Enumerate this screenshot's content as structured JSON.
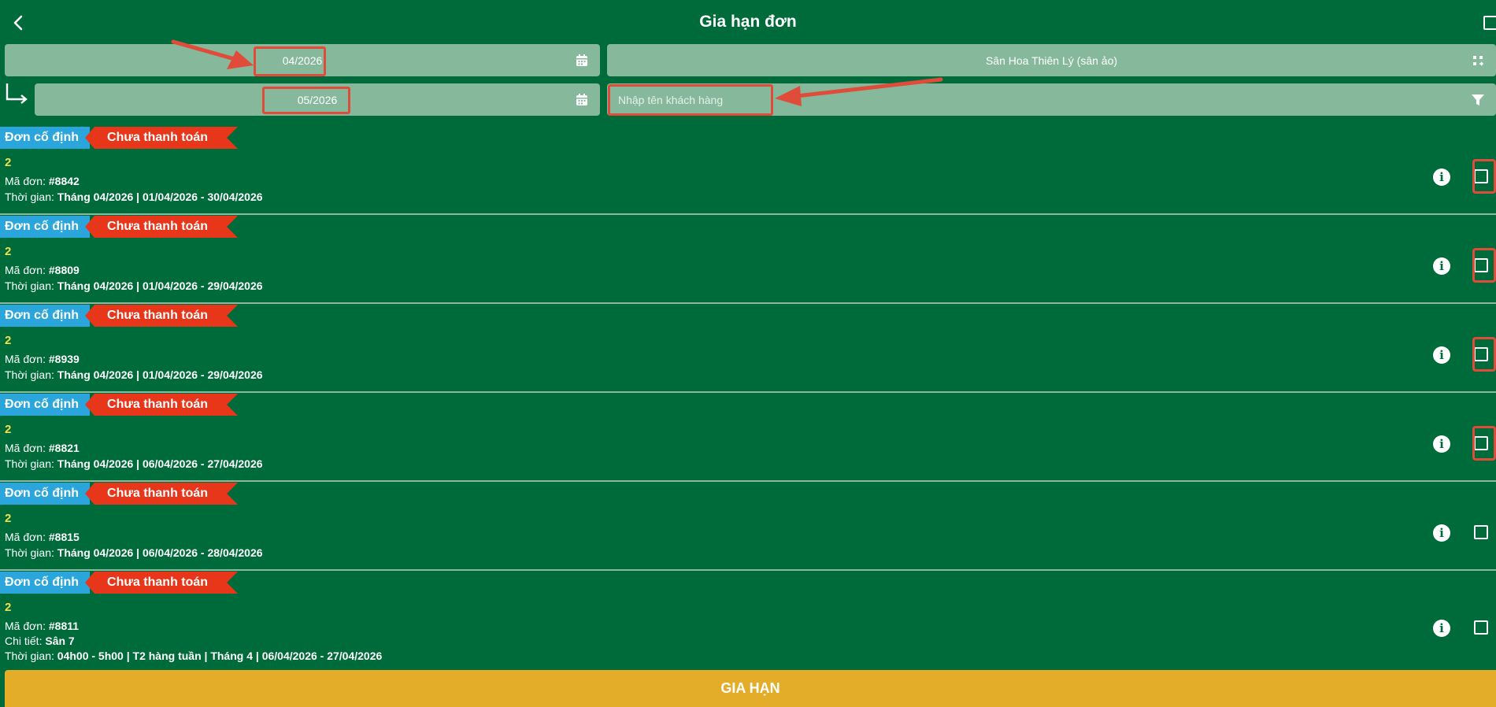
{
  "header": {
    "title": "Gia hạn đơn"
  },
  "filters": {
    "from_month": "04/2026",
    "to_month": "05/2026",
    "venue": "Sân Hoa Thiên Lý (sân ảo)",
    "customer_placeholder": "Nhập tên khách hàng"
  },
  "labels": {
    "order_code": "Mã đơn:",
    "time": "Thời gian:",
    "detail": "Chi tiết:"
  },
  "orders": [
    {
      "tag_type": "Đơn cố định",
      "tag_status": "Chưa thanh toán",
      "count": "2",
      "code": "#8842",
      "time": "Tháng 04/2026 | 01/04/2026 - 30/04/2026"
    },
    {
      "tag_type": "Đơn cố định",
      "tag_status": "Chưa thanh toán",
      "count": "2",
      "code": "#8809",
      "time": "Tháng 04/2026 | 01/04/2026 - 29/04/2026"
    },
    {
      "tag_type": "Đơn cố định",
      "tag_status": "Chưa thanh toán",
      "count": "2",
      "code": "#8939",
      "time": "Tháng 04/2026 | 01/04/2026 - 29/04/2026"
    },
    {
      "tag_type": "Đơn cố định",
      "tag_status": "Chưa thanh toán",
      "count": "2",
      "code": "#8821",
      "time": "Tháng 04/2026 | 06/04/2026 - 27/04/2026"
    },
    {
      "tag_type": "Đơn cố định",
      "tag_status": "Chưa thanh toán",
      "count": "2",
      "code": "#8815",
      "time": "Tháng 04/2026 | 06/04/2026 - 28/04/2026"
    },
    {
      "tag_type": "Đơn cố định",
      "tag_status": "Chưa thanh toán",
      "count": "2",
      "code": "#8811",
      "detail": "Sân 7",
      "time": "04h00 - 5h00 | T2 hàng tuần | Tháng 4 | 06/04/2026 - 27/04/2026"
    }
  ],
  "footer": {
    "extend_label": "GIA HẠN"
  },
  "colors": {
    "background": "#006b3a",
    "field": "#86b99b",
    "tag_blue": "#2aa6dc",
    "tag_red": "#e8361a",
    "count_yellow": "#f3df4a",
    "footer_button": "#e3ad2a",
    "annotation_red": "#e04b3a"
  }
}
